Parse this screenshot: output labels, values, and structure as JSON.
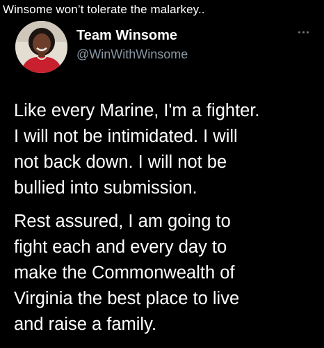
{
  "caption": "Winsome won’t tolerate the malarkey..",
  "tweet": {
    "display_name": "Team Winsome",
    "handle": "@WinWithWinsome",
    "avatar_icon": "profile-photo",
    "more_icon": "more-options-icon",
    "paragraphs": [
      {
        "lines": [
          "Like every Marine, I'm a fighter.",
          "I will not be intimidated. I will",
          "not back down. I will not be",
          "bullied into submission."
        ]
      },
      {
        "lines": [
          "Rest assured, I am going to",
          "fight each and every day to",
          "make the Commonwealth of",
          "Virginia the best place to live",
          "and raise a family."
        ]
      }
    ]
  },
  "colors": {
    "background": "#000000",
    "text": "#ffffff",
    "handle": "#8b98a5",
    "avatar_dress": "#c8202e"
  }
}
